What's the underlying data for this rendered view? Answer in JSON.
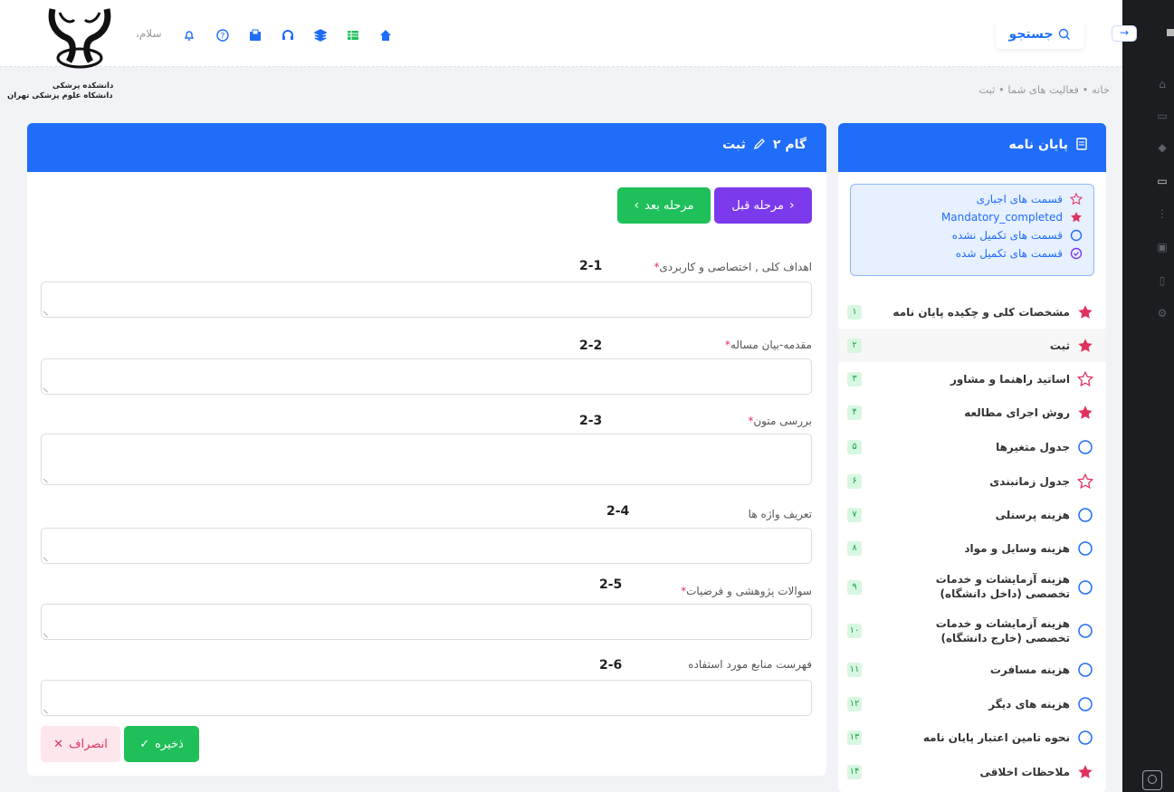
{
  "header": {
    "search_label": "جستجو",
    "hello": "سلام،",
    "uni_line1": "دانشکده پرشکی",
    "uni_line2": "دانشکاه علوم پزشکی تهران"
  },
  "breadcrumb": "خانه • فعالیت های شما • ثبت",
  "sidebar": {
    "title": "پایان نامه",
    "legend": [
      {
        "label": "قسمت های اجباری",
        "icon": "star-outline-icon"
      },
      {
        "label": "Mandatory_completed",
        "icon": "star-filled-icon"
      },
      {
        "label": "قسمت های تکمیل نشده",
        "icon": "circle-icon"
      },
      {
        "label": "قسمت های تکمیل شده",
        "icon": "check-circle-icon"
      }
    ],
    "items": [
      {
        "label": "مشخصات کلی و چکیده پایان نامه",
        "num": "۱",
        "icon": "star-filled"
      },
      {
        "label": "ثبت",
        "num": "۲",
        "icon": "star-filled"
      },
      {
        "label": "اساتید راهنما و مشاور",
        "num": "۳",
        "icon": "star-outline"
      },
      {
        "label": "روش اجرای مطالعه",
        "num": "۴",
        "icon": "star-filled"
      },
      {
        "label": "جدول متغیرها",
        "num": "۵",
        "icon": "circle"
      },
      {
        "label": "جدول زمانبندی",
        "num": "۶",
        "icon": "star-outline"
      },
      {
        "label": "هزینه پرسنلی",
        "num": "۷",
        "icon": "circle"
      },
      {
        "label": "هزینه وسایل و مواد",
        "num": "۸",
        "icon": "circle"
      },
      {
        "label": "هزینه آزمایشات و خدمات تخصصی (داخل دانشگاه)",
        "num": "۹",
        "icon": "circle"
      },
      {
        "label": "هزینه آزمایشات و خدمات تخصصی (خارج دانشگاه)",
        "num": "۱۰",
        "icon": "circle"
      },
      {
        "label": "هزینه مسافرت",
        "num": "۱۱",
        "icon": "circle"
      },
      {
        "label": "هزینه های دیگر",
        "num": "۱۲",
        "icon": "circle"
      },
      {
        "label": "نحوه تامین اعتبار پایان نامه",
        "num": "۱۳",
        "icon": "circle"
      },
      {
        "label": "ملاحظات اخلاقی",
        "num": "۱۴",
        "icon": "star-filled"
      }
    ]
  },
  "main": {
    "title": "گام ۲",
    "subtitle": "ثبت",
    "prev_label": "مرحله قبل",
    "next_label": "مرحله بعد",
    "fields": [
      {
        "label": "اهداف کلی , اختصاصی و کاربردی",
        "required": "*",
        "num": "2-1"
      },
      {
        "label": "مقدمه-بیان مساله",
        "required": "*",
        "num": "2-2"
      },
      {
        "label": "بررسی متون",
        "required": "*",
        "num": "2-3"
      },
      {
        "label": "تعریف واژه ها",
        "required": "",
        "num": "2-4"
      },
      {
        "label": "سوالات پژوهشی و فرضیات",
        "required": "*",
        "num": "2-5"
      },
      {
        "label": "فهرست منابع مورد استفاده",
        "required": "",
        "num": "2-6"
      }
    ],
    "save_label": "ذخیره",
    "cancel_label": "انصراف"
  },
  "colors": {
    "primary": "#1f6df8",
    "purple": "#7c3aed",
    "green": "#1fbf5a",
    "pink": "#e0315f"
  }
}
